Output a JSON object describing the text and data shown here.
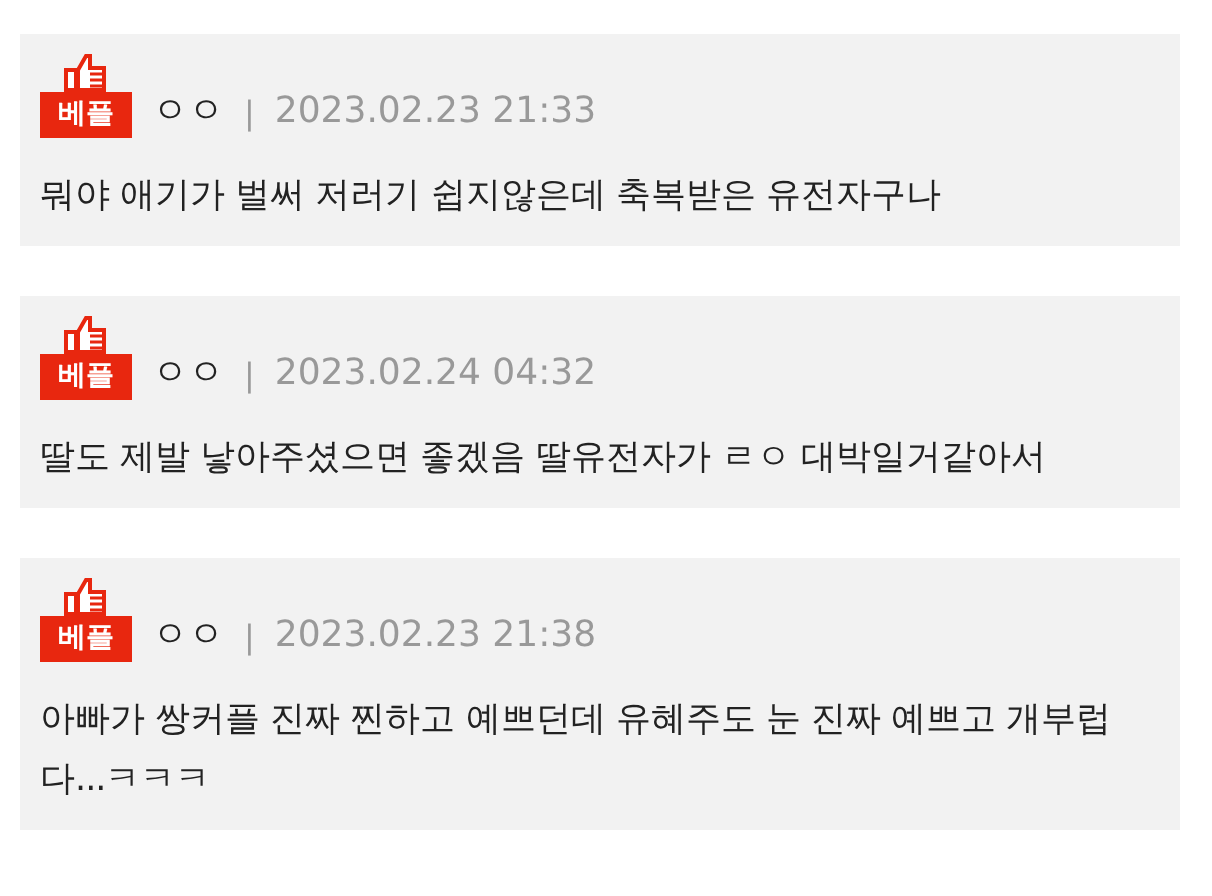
{
  "comments": [
    {
      "badge": "베플",
      "author": "ㅇㅇ",
      "separator": "|",
      "date": "2023.02.23 21:33",
      "text": "뭐야 애기가 벌써 저러기 쉽지않은데 축복받은 유전자구나"
    },
    {
      "badge": "베플",
      "author": "ㅇㅇ",
      "separator": "|",
      "date": "2023.02.24 04:32",
      "text": "딸도 제발 낳아주셨으면 좋겠음 딸유전자가 ㄹㅇ 대박일거같아서"
    },
    {
      "badge": "베플",
      "author": "ㅇㅇ",
      "separator": "|",
      "date": "2023.02.23 21:38",
      "text": "아빠가 쌍커플 진짜 찐하고 예쁘던데 유혜주도 눈 진짜 예쁘고 개부럽다...ㅋㅋㅋ"
    }
  ]
}
